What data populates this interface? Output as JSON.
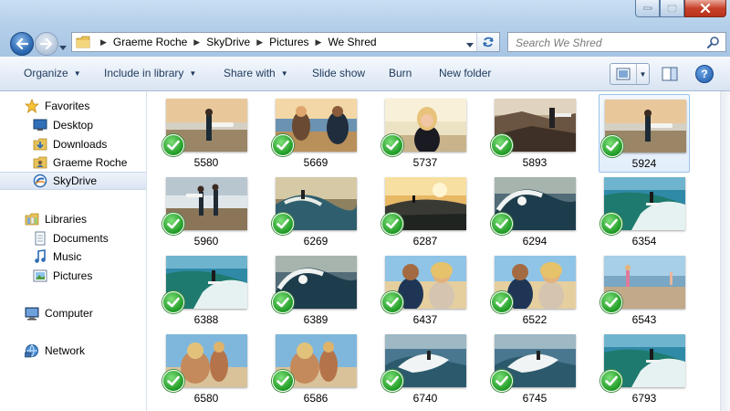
{
  "window": {
    "path": [
      "Graeme Roche",
      "SkyDrive",
      "Pictures",
      "We Shred"
    ],
    "search_placeholder": "Search We Shred"
  },
  "toolbar": {
    "commands": [
      {
        "label": "Organize",
        "has_dropdown": true
      },
      {
        "label": "Include in library",
        "has_dropdown": true
      },
      {
        "label": "Share with",
        "has_dropdown": true
      },
      {
        "label": "Slide show",
        "has_dropdown": false
      },
      {
        "label": "Burn",
        "has_dropdown": false
      },
      {
        "label": "New folder",
        "has_dropdown": false
      }
    ],
    "help_label": "?"
  },
  "sidebar": {
    "favorites": {
      "label": "Favorites",
      "icon": "star-icon",
      "items": [
        {
          "label": "Desktop",
          "icon": "desktop-icon"
        },
        {
          "label": "Downloads",
          "icon": "downloads-icon"
        },
        {
          "label": "Graeme Roche",
          "icon": "user-folder-icon"
        },
        {
          "label": "SkyDrive",
          "icon": "skydrive-icon",
          "selected": true
        }
      ]
    },
    "libraries": {
      "label": "Libraries",
      "icon": "libraries-icon",
      "items": [
        {
          "label": "Documents",
          "icon": "documents-icon"
        },
        {
          "label": "Music",
          "icon": "music-icon"
        },
        {
          "label": "Pictures",
          "icon": "pictures-icon"
        }
      ]
    },
    "computer": {
      "label": "Computer",
      "icon": "computer-icon"
    },
    "network": {
      "label": "Network",
      "icon": "network-icon"
    }
  },
  "files": [
    {
      "name": "5580",
      "scene": "beach-walk",
      "synced": true
    },
    {
      "name": "5669",
      "scene": "couple",
      "synced": true
    },
    {
      "name": "5737",
      "scene": "girl",
      "synced": true
    },
    {
      "name": "5893",
      "scene": "rocks",
      "synced": true
    },
    {
      "name": "5924",
      "scene": "beach-walk",
      "synced": true,
      "selected": true
    },
    {
      "name": "5960",
      "scene": "beach-pair",
      "synced": true
    },
    {
      "name": "6269",
      "scene": "wave",
      "synced": true
    },
    {
      "name": "6287",
      "scene": "sunset-wave",
      "synced": true
    },
    {
      "name": "6294",
      "scene": "big-wave",
      "synced": true
    },
    {
      "name": "6354",
      "scene": "green-wave",
      "synced": true
    },
    {
      "name": "6388",
      "scene": "green-wave",
      "synced": true
    },
    {
      "name": "6389",
      "scene": "big-wave",
      "synced": true
    },
    {
      "name": "6437",
      "scene": "couple-beach",
      "synced": true
    },
    {
      "name": "6522",
      "scene": "couple-beach",
      "synced": true
    },
    {
      "name": "6543",
      "scene": "runner",
      "synced": true
    },
    {
      "name": "6580",
      "scene": "carry",
      "synced": true
    },
    {
      "name": "6586",
      "scene": "carry",
      "synced": true
    },
    {
      "name": "6740",
      "scene": "white-wave",
      "synced": true
    },
    {
      "name": "6745",
      "scene": "white-wave",
      "synced": true
    },
    {
      "name": "6793",
      "scene": "green-wave",
      "synced": true
    }
  ],
  "colors": {
    "sync_check": "#1e9a24",
    "selection": "#99c3ea",
    "command_text": "#1e395b"
  }
}
